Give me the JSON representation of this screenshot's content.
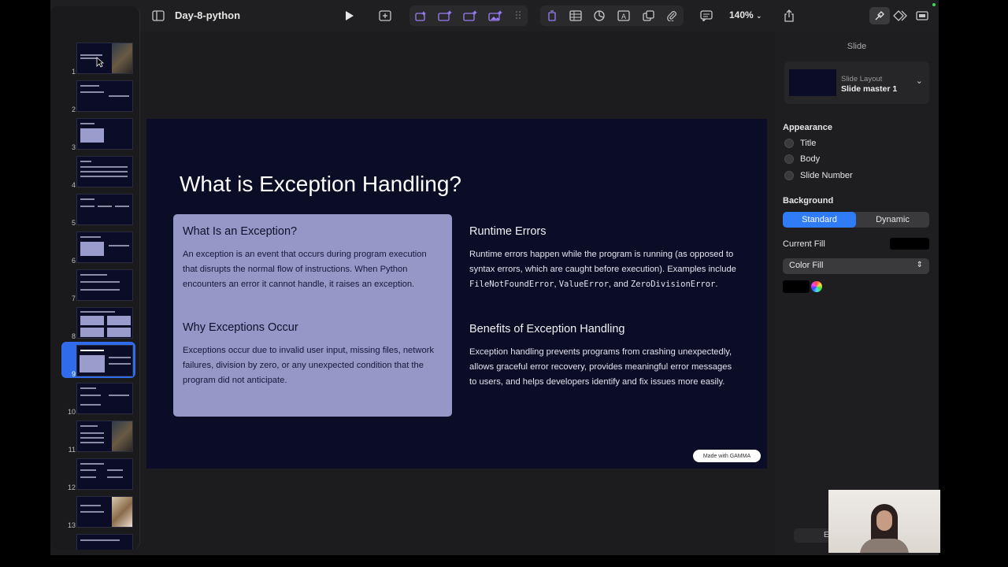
{
  "toolbar": {
    "doc_title": "Day-8-python",
    "zoom": "140%"
  },
  "sidebar": {
    "slides": [
      {
        "num": "1"
      },
      {
        "num": "2"
      },
      {
        "num": "3"
      },
      {
        "num": "4"
      },
      {
        "num": "5"
      },
      {
        "num": "6"
      },
      {
        "num": "7"
      },
      {
        "num": "8"
      },
      {
        "num": "9",
        "active": true
      },
      {
        "num": "10"
      },
      {
        "num": "11"
      },
      {
        "num": "12"
      },
      {
        "num": "13"
      }
    ]
  },
  "slide": {
    "title": "What is Exception Handling?",
    "card": {
      "h1": "What Is an Exception?",
      "p1": "An exception is an event that occurs during program execution that disrupts the normal flow of instructions. When Python encounters an error it cannot handle, it raises an exception.",
      "h2": "Why Exceptions Occur",
      "p2": "Exceptions occur due to invalid user input, missing files, network failures, division by zero, or any unexpected condition that the program did not anticipate."
    },
    "right": {
      "h1": "Runtime Errors",
      "p1_start": "Runtime errors happen while the program is running (as opposed to syntax errors, which are caught before execution). Examples include ",
      "code1": "FileNotFoundError",
      "sep1": ", ",
      "code2": "ValueError",
      "sep2": ", and ",
      "code3": "ZeroDivisionError",
      "end": ".",
      "h2": "Benefits of Exception Handling",
      "p2": "Exception handling prevents programs from crashing unexpectedly, allows graceful error recovery, provides meaningful error messages to users, and helps developers identify and fix issues more easily."
    },
    "badge": "Made with GAMMA"
  },
  "inspector": {
    "title": "Slide",
    "layout_label": "Slide Layout",
    "layout_value": "Slide master 1",
    "appearance_heading": "Appearance",
    "appearance_options": [
      "Title",
      "Body",
      "Slide Number"
    ],
    "background_heading": "Background",
    "segment_standard": "Standard",
    "segment_dynamic": "Dynamic",
    "current_fill_label": "Current Fill",
    "fill_type": "Color Fill",
    "fill_color": "#000000"
  },
  "misc": {
    "ghost_button": "E"
  }
}
